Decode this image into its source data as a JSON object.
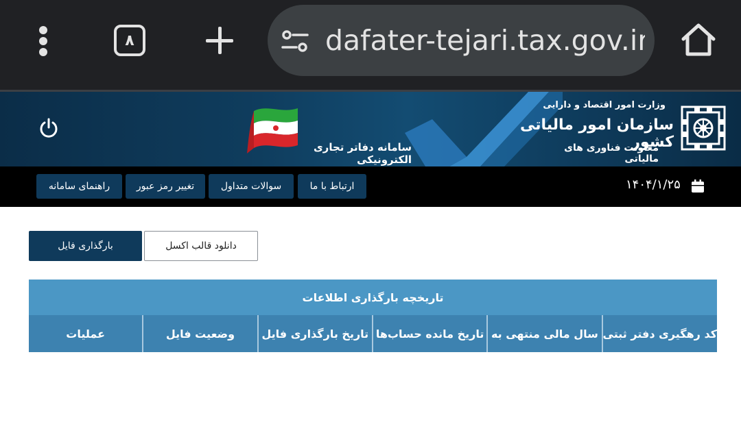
{
  "browser": {
    "tab_count": "٨",
    "url": "dafater-tejari.tax.gov.ir/t"
  },
  "banner": {
    "ministry": "وزارت امور اقتصاد و دارایی",
    "org_name": "سازمان امور مالیاتی کشور",
    "deputy": "معاونت فناوری های مالیاتی",
    "system_name": "سامانه دفاتر تجاری الکترونیکی"
  },
  "nav": {
    "items": [
      {
        "label": "ارتباط با ما"
      },
      {
        "label": "سوالات متداول"
      },
      {
        "label": "تغییر رمز عبور"
      },
      {
        "label": "راهنمای سامانه"
      }
    ],
    "date": "۱۴۰۴/۱/۲۵"
  },
  "actions": {
    "upload_label": "بارگذاری فایل",
    "download_label": "دانلود قالب اکسل"
  },
  "table": {
    "title": "تاریخچه بارگذاری اطلاعات",
    "columns": [
      "کد رهگیری دفتر ثبتی",
      "سال مالی منتهی به",
      "تاریخ مانده حساب‌ها",
      "تاریخ بارگذاری فایل",
      "وضعیت فایل",
      "عملیات"
    ]
  },
  "colors": {
    "chrome_bg": "#202124",
    "banner_bg": "#0f3d5e",
    "nav_bg": "#000000",
    "button_dark": "#0f3a5b",
    "table_title_bg": "#4b97c5",
    "table_header_bg": "#3d82b0"
  }
}
